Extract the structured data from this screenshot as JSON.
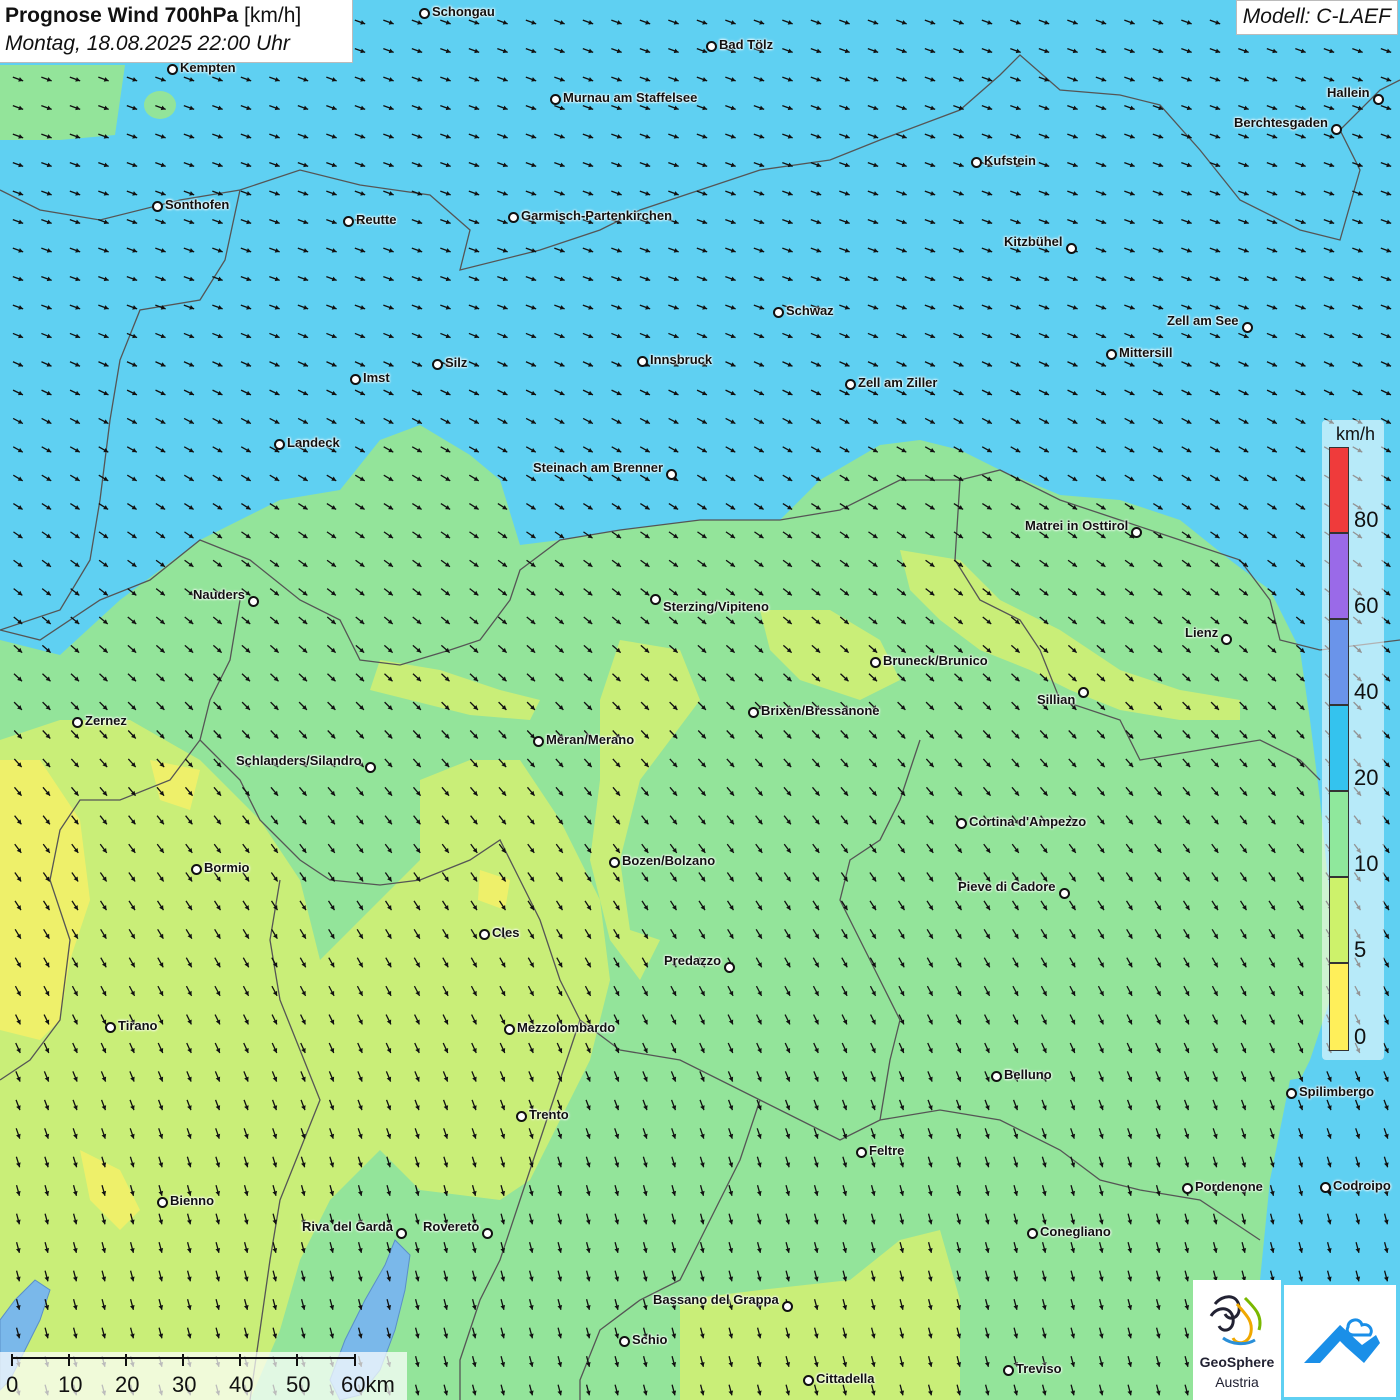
{
  "header": {
    "title_bold": "Prognose Wind 700hPa",
    "title_unit": "[km/h]",
    "datetime": "Montag, 18.08.2025 22:00 Uhr",
    "model": "Modell: C-LAEF"
  },
  "legend": {
    "unit": "km/h",
    "ticks": [
      "80",
      "60",
      "40",
      "20",
      "10",
      "5",
      "0"
    ],
    "colors": [
      "#ef3b3b",
      "#9a6ae8",
      "#6a94ea",
      "#34c3ee",
      "#8fe89c",
      "#cdf26b",
      "#ffef5a"
    ]
  },
  "scale_bar": {
    "labels": [
      "0",
      "10",
      "20",
      "30",
      "40",
      "50",
      "60km"
    ]
  },
  "logos": {
    "geosphere_line1": "GeoSphere",
    "geosphere_line2": "Austria",
    "geosphere_icon": "geosphere-swirl-icon",
    "app_icon": "warnapp-mountain-icon"
  },
  "map_colors": {
    "wind_20_40": "#5fd0f2",
    "wind_10_20": "#93e49a",
    "wind_5_10": "#c9ee78",
    "wind_0_5": "#eef06a",
    "arrow": "#111111",
    "border": "#555555"
  },
  "cities": [
    {
      "name": "Schongau"
    },
    {
      "name": "Bad Tölz"
    },
    {
      "name": "Kempten"
    },
    {
      "name": "Murnau am Staffelsee"
    },
    {
      "name": "Hallein"
    },
    {
      "name": "Berchtesgaden"
    },
    {
      "name": "Kufstein"
    },
    {
      "name": "Sonthofen"
    },
    {
      "name": "Reutte"
    },
    {
      "name": "Garmisch-Partenkirchen"
    },
    {
      "name": "Kitzbühel"
    },
    {
      "name": "Schwaz"
    },
    {
      "name": "Zell am See"
    },
    {
      "name": "Mittersill"
    },
    {
      "name": "Innsbruck"
    },
    {
      "name": "Silz"
    },
    {
      "name": "Imst"
    },
    {
      "name": "Zell am Ziller"
    },
    {
      "name": "Landeck"
    },
    {
      "name": "Steinach am Brenner"
    },
    {
      "name": "Matrei in Osttirol"
    },
    {
      "name": "Nauders"
    },
    {
      "name": "Sterzing/Vipiteno"
    },
    {
      "name": "Lienz"
    },
    {
      "name": "Bruneck/Brunico"
    },
    {
      "name": "Sillian"
    },
    {
      "name": "Brixen/Bressanone"
    },
    {
      "name": "Zernez"
    },
    {
      "name": "Meran/Merano"
    },
    {
      "name": "Schlanders/Silandro"
    },
    {
      "name": "Cortina d'Ampezzo"
    },
    {
      "name": "Bozen/Bolzano"
    },
    {
      "name": "Bormio"
    },
    {
      "name": "Pieve di Cadore"
    },
    {
      "name": "Cles"
    },
    {
      "name": "Predazzo"
    },
    {
      "name": "Tirano"
    },
    {
      "name": "Mezzolombardo"
    },
    {
      "name": "Belluno"
    },
    {
      "name": "Spilimbergo"
    },
    {
      "name": "Trento"
    },
    {
      "name": "Feltre"
    },
    {
      "name": "Pordenone"
    },
    {
      "name": "Codroipo"
    },
    {
      "name": "Bienno"
    },
    {
      "name": "Riva del Garda"
    },
    {
      "name": "Rovereto"
    },
    {
      "name": "Conegliano"
    },
    {
      "name": "Bassano del Grappa"
    },
    {
      "name": "Schio"
    },
    {
      "name": "Treviso"
    },
    {
      "name": "Cittadella"
    }
  ]
}
